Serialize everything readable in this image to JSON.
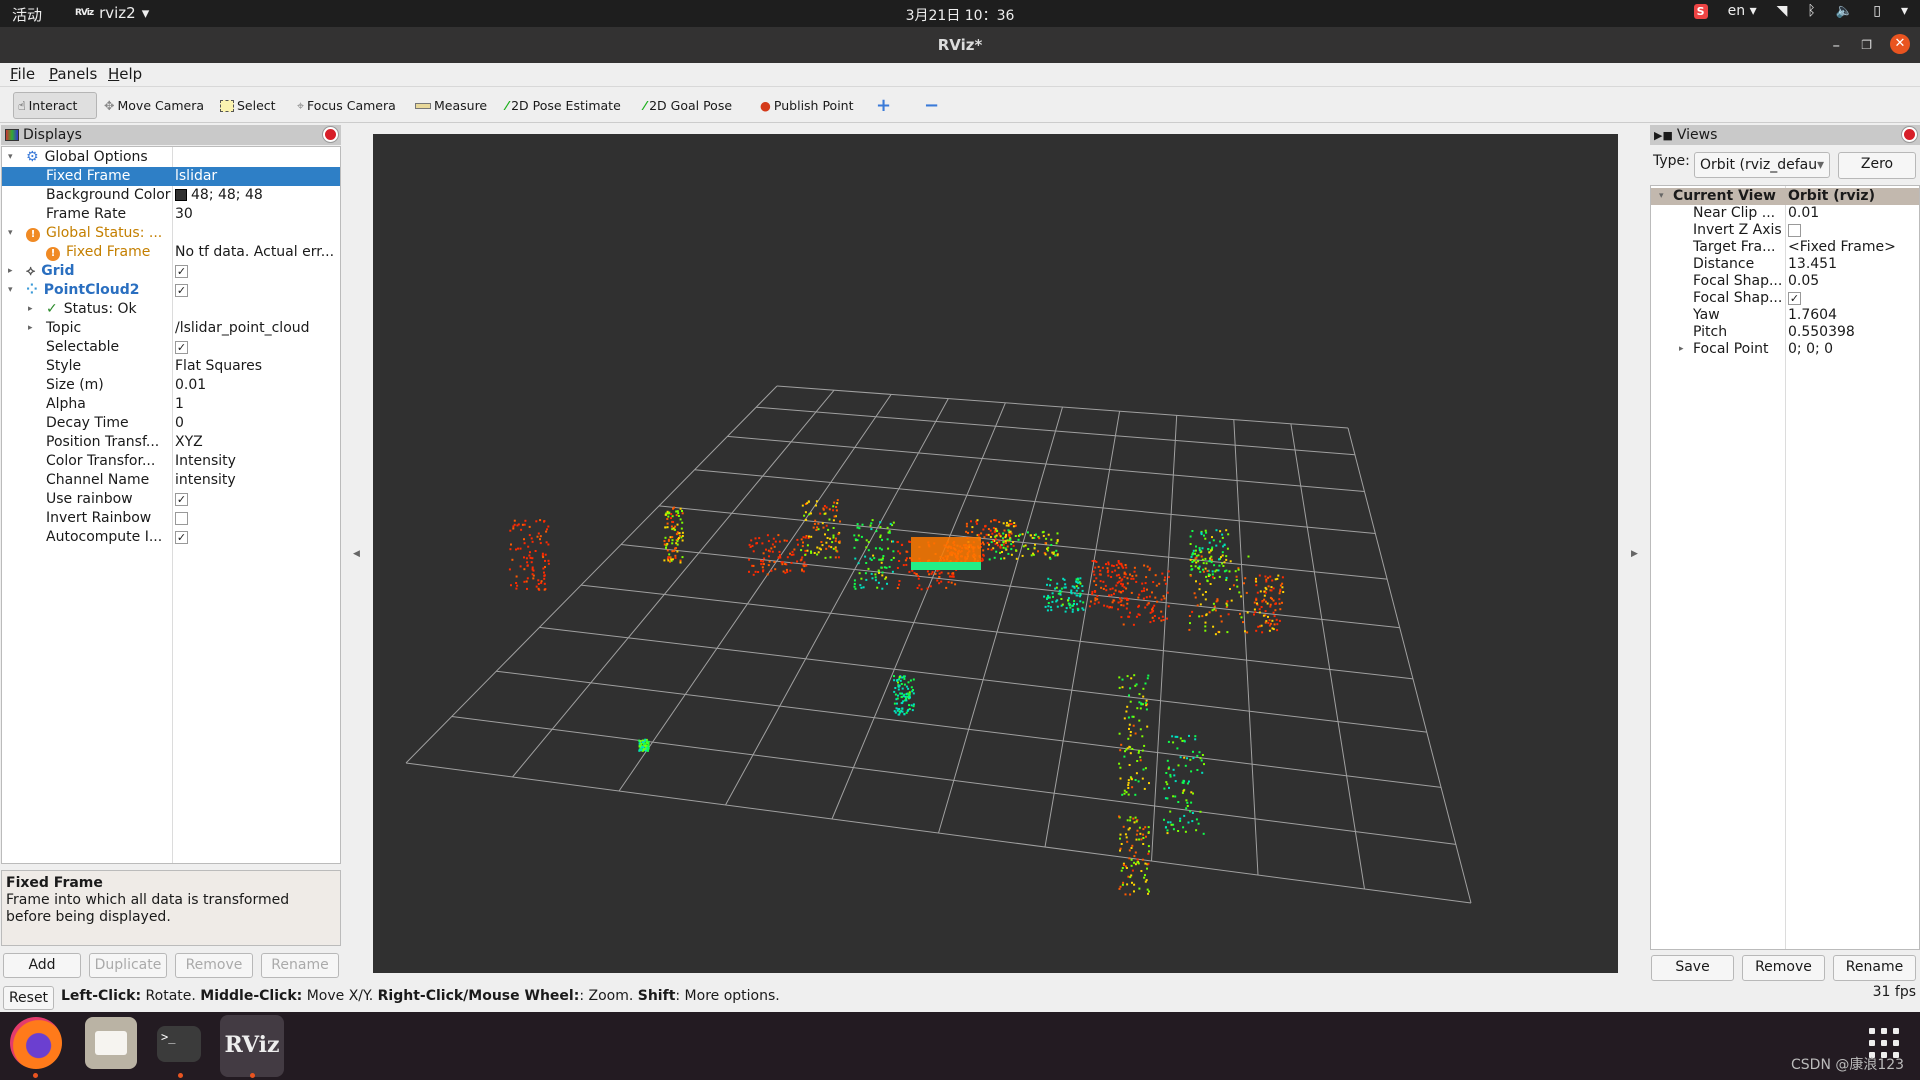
{
  "topbar": {
    "activities": "活动",
    "app_logo": "RViz",
    "app_name": "rviz2",
    "clock": "3月21日  10：36",
    "input_method": "S",
    "language": "en"
  },
  "window": {
    "title": "RViz*"
  },
  "menu": {
    "items": [
      {
        "label": "File",
        "mnemonic": "F",
        "rest": "ile"
      },
      {
        "label": "Panels",
        "mnemonic": "P",
        "rest": "anels"
      },
      {
        "label": "Help",
        "mnemonic": "H",
        "rest": "elp"
      }
    ]
  },
  "toolbar": {
    "tools": [
      {
        "label": "Interact",
        "icon": "hand-icon",
        "active": true
      },
      {
        "label": "Move Camera",
        "icon": "move-camera-icon"
      },
      {
        "label": "Select",
        "icon": "select-icon"
      },
      {
        "label": "Focus Camera",
        "icon": "focus-camera-icon"
      },
      {
        "label": "Measure",
        "icon": "ruler-icon"
      },
      {
        "label": "2D Pose Estimate",
        "icon": "green-arrow-icon"
      },
      {
        "label": "2D Goal Pose",
        "icon": "green-arrow-icon"
      },
      {
        "label": "Publish Point",
        "icon": "map-pin-icon"
      }
    ],
    "add_symbol": "+",
    "remove_symbol": "−"
  },
  "displays": {
    "title": "Displays",
    "rows": [
      {
        "key": "Global Options",
        "value": "",
        "level": 0,
        "expand": "open",
        "icon": "gear"
      },
      {
        "key": "Fixed Frame",
        "value": "lslidar",
        "level": 1,
        "selected": true
      },
      {
        "key": "Background Color",
        "value": "48; 48; 48",
        "level": 1,
        "swatch": "#303030"
      },
      {
        "key": "Frame Rate",
        "value": "30",
        "level": 1
      },
      {
        "key": "Global Status: ...",
        "value": "",
        "level": 0,
        "expand": "open",
        "icon": "warn",
        "style": "orange"
      },
      {
        "key": "Fixed Frame",
        "value": "No tf data.  Actual err...",
        "level": 1,
        "icon": "warn",
        "style": "orange"
      },
      {
        "key": "Grid",
        "value": "",
        "level": 0,
        "expand": "closed",
        "icon": "grid",
        "style": "blue",
        "checkbox": true
      },
      {
        "key": "PointCloud2",
        "value": "",
        "level": 0,
        "expand": "open",
        "icon": "cloud",
        "style": "blue",
        "checkbox": true
      },
      {
        "key": "Status: Ok",
        "value": "",
        "level": 1,
        "expand": "closed",
        "icon": "check"
      },
      {
        "key": "Topic",
        "value": "/lslidar_point_cloud",
        "level": 1,
        "expand": "closed"
      },
      {
        "key": "Selectable",
        "value": "",
        "level": 1,
        "checkbox": true
      },
      {
        "key": "Style",
        "value": "Flat Squares",
        "level": 1
      },
      {
        "key": "Size (m)",
        "value": "0.01",
        "level": 1
      },
      {
        "key": "Alpha",
        "value": "1",
        "level": 1
      },
      {
        "key": "Decay Time",
        "value": "0",
        "level": 1
      },
      {
        "key": "Position Transf...",
        "value": "XYZ",
        "level": 1
      },
      {
        "key": "Color Transfor...",
        "value": "Intensity",
        "level": 1
      },
      {
        "key": "Channel Name",
        "value": "intensity",
        "level": 1
      },
      {
        "key": "Use rainbow",
        "value": "",
        "level": 1,
        "checkbox": true
      },
      {
        "key": "Invert Rainbow",
        "value": "",
        "level": 1,
        "checkbox": false
      },
      {
        "key": "Autocompute I...",
        "value": "",
        "level": 1,
        "checkbox": true
      }
    ],
    "description_title": "Fixed Frame",
    "description_text": "Frame into which all data is transformed before being displayed.",
    "buttons": {
      "add": "Add",
      "duplicate": "Duplicate",
      "remove": "Remove",
      "rename": "Rename"
    }
  },
  "viewport": {
    "background": "#303030",
    "grid_cells": 10,
    "grid_color": "#a0a0a0"
  },
  "views": {
    "title": "Views",
    "type_label": "Type:",
    "type_value": "Orbit (rviz_defau",
    "zero_button": "Zero",
    "header_key": "Current View",
    "header_value": "Orbit (rviz)",
    "rows": [
      {
        "key": "Near Clip ...",
        "value": "0.01"
      },
      {
        "key": "Invert Z Axis",
        "value": "",
        "checkbox": false
      },
      {
        "key": "Target Fra...",
        "value": "<Fixed Frame>"
      },
      {
        "key": "Distance",
        "value": "13.451"
      },
      {
        "key": "Focal Shap...",
        "value": "0.05"
      },
      {
        "key": "Focal Shap...",
        "value": "",
        "checkbox": true
      },
      {
        "key": "Yaw",
        "value": "1.7604"
      },
      {
        "key": "Pitch",
        "value": "0.550398"
      },
      {
        "key": "Focal Point",
        "value": "0; 0; 0",
        "expand": "closed"
      }
    ],
    "buttons": {
      "save": "Save",
      "remove": "Remove",
      "rename": "Rename"
    }
  },
  "statusbar": {
    "reset": "Reset",
    "hint": [
      {
        "b": "Left-Click:",
        "t": " Rotate. "
      },
      {
        "b": "Middle-Click:",
        "t": " Move X/Y. "
      },
      {
        "b": "Right-Click/Mouse Wheel:",
        "t": ": Zoom. "
      },
      {
        "b": "Shift",
        "t": ": More options."
      }
    ],
    "fps": "31 fps"
  },
  "dock": {
    "apps": [
      {
        "name": "Firefox",
        "running": true
      },
      {
        "name": "Files",
        "running": false
      },
      {
        "name": "Terminal",
        "running": true,
        "glyph": ">_"
      },
      {
        "name": "RViz",
        "running": true,
        "glyph": "RViz"
      }
    ],
    "watermark": "CSDN @康浪123"
  }
}
